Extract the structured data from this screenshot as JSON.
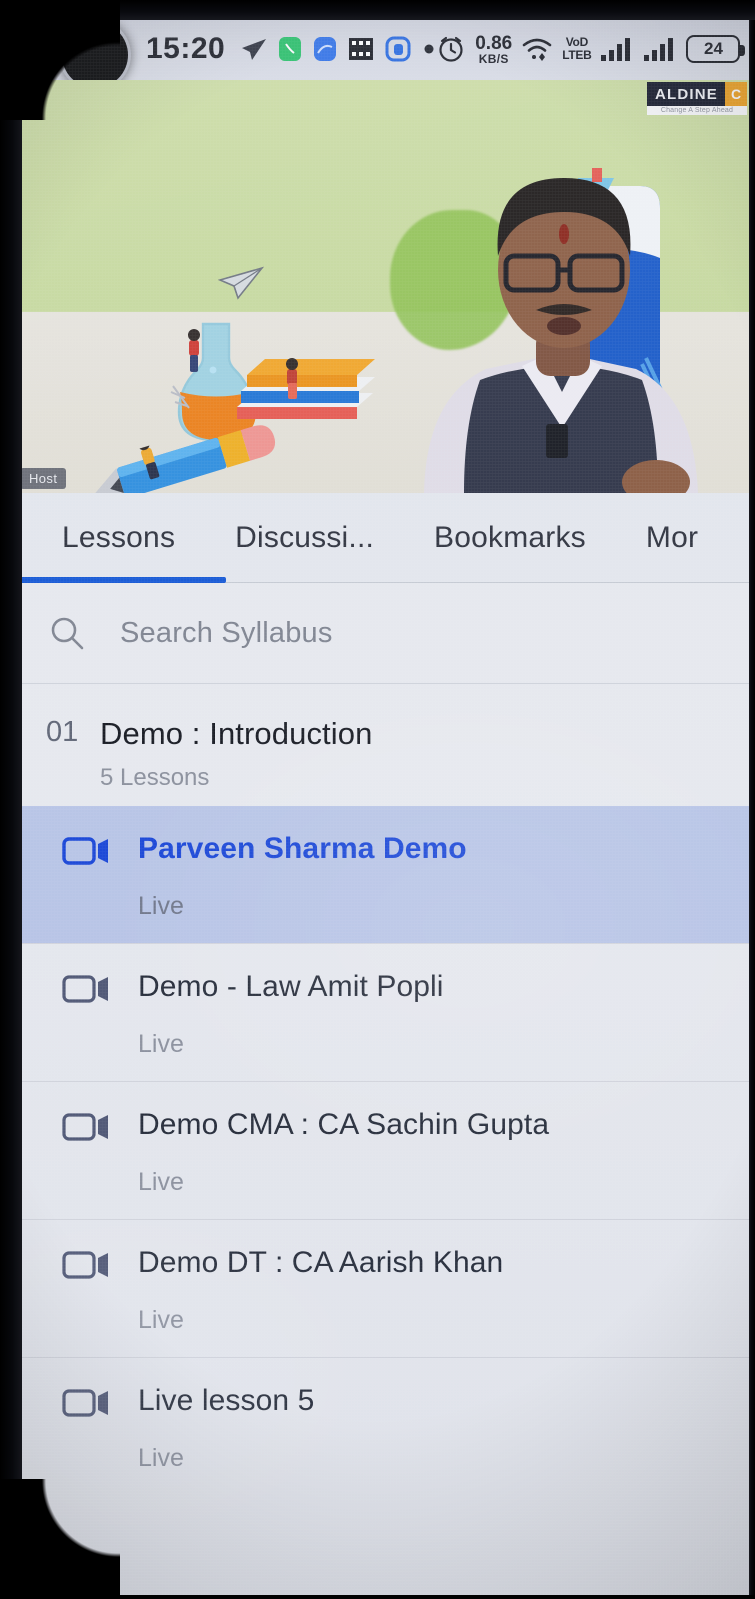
{
  "status_bar": {
    "time": "15:20",
    "left_icons": [
      "telegram-icon",
      "whatsapp-icon",
      "messenger-icon",
      "gallery-icon",
      "app-icon",
      "dot-icon"
    ],
    "alarm_icon": "alarm-icon",
    "net_speed_value": "0.86",
    "net_speed_unit": "KB/S",
    "wifi_icon": "wifi-icon",
    "volte_line1": "VoD",
    "volte_line2": "LTEB",
    "signal_icon_1": "signal-bars-icon",
    "signal_icon_2": "signal-bars-icon",
    "battery_level": "24"
  },
  "video": {
    "host_badge": "Host",
    "logo_name": "ALDINE",
    "logo_mark": "C",
    "logo_tagline": "Change A Step Ahead",
    "background_theme": "education-illustration"
  },
  "tabs": {
    "items": [
      {
        "label": "Lessons",
        "active": true
      },
      {
        "label": "Discussi...",
        "active": false
      },
      {
        "label": "Bookmarks",
        "active": false
      },
      {
        "label": "Mor",
        "active": false
      }
    ],
    "underline_color": "#1156d6"
  },
  "search": {
    "icon": "search-icon",
    "placeholder": "Search Syllabus",
    "value": ""
  },
  "section": {
    "index": "01",
    "title": "Demo : Introduction",
    "subtitle": "5 Lessons"
  },
  "lessons": [
    {
      "icon": "video-camera-icon",
      "name": "Parveen Sharma Demo",
      "meta": "Live",
      "active": true
    },
    {
      "icon": "video-camera-icon",
      "name": "Demo - Law Amit Popli",
      "meta": "Live",
      "active": false
    },
    {
      "icon": "video-camera-icon",
      "name": "Demo CMA : CA Sachin Gupta",
      "meta": "Live",
      "active": false
    },
    {
      "icon": "video-camera-icon",
      "name": "Demo DT : CA Aarish Khan",
      "meta": "Live",
      "active": false
    },
    {
      "icon": "video-camera-icon",
      "name": "Live lesson 5",
      "meta": "Live",
      "active": false
    }
  ],
  "colors": {
    "accent": "#1156d6",
    "active_row_bg": "#b9c6e8",
    "active_row_text": "#1241d8",
    "sheet_bg": "#e9ebf0",
    "muted_text": "#8b909c"
  }
}
